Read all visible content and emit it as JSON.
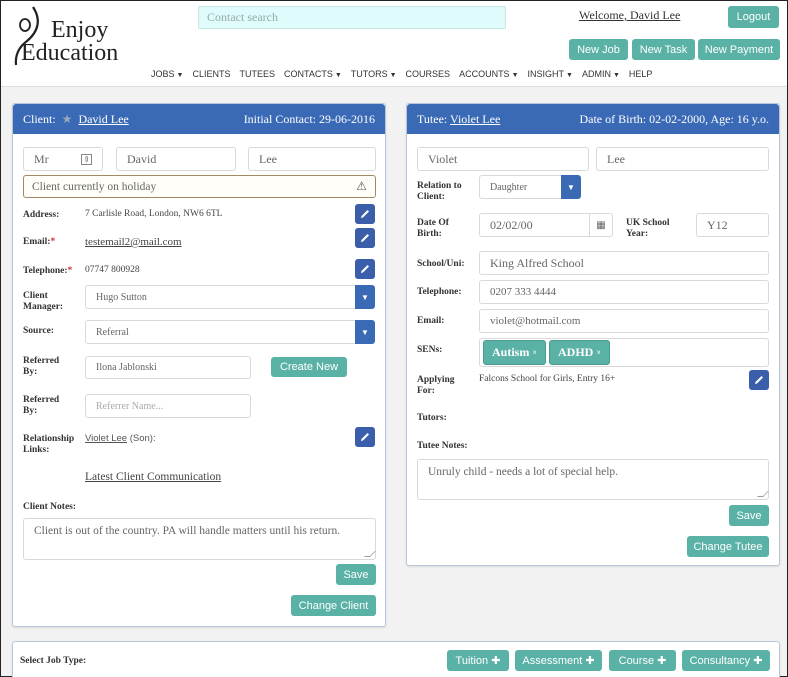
{
  "header": {
    "logo": {
      "line1": "Enjoy",
      "line2": "Education"
    },
    "search_placeholder": "Contact search",
    "welcome": "Welcome, David Lee",
    "logout": "Logout",
    "actions": [
      "New Job",
      "New Task",
      "New Payment"
    ]
  },
  "nav": [
    {
      "label": "JOBS",
      "dropdown": true
    },
    {
      "label": "CLIENTS",
      "dropdown": false
    },
    {
      "label": "TUTEES",
      "dropdown": false
    },
    {
      "label": "CONTACTS",
      "dropdown": true
    },
    {
      "label": "TUTORS",
      "dropdown": true
    },
    {
      "label": "COURSES",
      "dropdown": false
    },
    {
      "label": "ACCOUNTS",
      "dropdown": true
    },
    {
      "label": "INSIGHT",
      "dropdown": true
    },
    {
      "label": "ADMIN",
      "dropdown": true
    },
    {
      "label": "HELP",
      "dropdown": false
    }
  ],
  "client": {
    "header_label": "Client:",
    "name_link": "David Lee",
    "initial_contact": "Initial Contact: 29-06-2016",
    "title": "Mr",
    "first_name": "David",
    "last_name": "Lee",
    "alert": "Client currently on holiday",
    "address_label": "Address:",
    "address": "7 Carlisle Road, London, NW6 6TL",
    "email_label": "Email:",
    "email": "testemail2@mail.com",
    "telephone_label": "Telephone:",
    "telephone": "07747 800928",
    "manager_label": "Client Manager:",
    "manager": "Hugo Sutton",
    "source_label": "Source:",
    "source": "Referral",
    "referred_label": "Referred By:",
    "referred_by": "Ilona Jablonski",
    "create_new": "Create New",
    "referred2_label": "Referred By:",
    "referrer_placeholder": "Referrer Name...",
    "relationship_label": "Relationship Links:",
    "relationship_link": "Violet Lee",
    "relationship_suffix": "(Son):",
    "latest_comm": "Latest Client Communication",
    "notes_label": "Client Notes:",
    "notes": "Client is out of the country. PA will handle matters until his return.",
    "save": "Save",
    "change": "Change Client"
  },
  "tutee": {
    "header_label": "Tutee:",
    "name_link": "Violet Lee",
    "dob_summary": "Date of Birth: 02-02-2000, Age: 16 y.o.",
    "first_name": "Violet",
    "last_name": "Lee",
    "relation_label": "Relation to Client:",
    "relation": "Daughter",
    "dob_label": "Date Of Birth:",
    "dob": "02/02/00",
    "school_year_label": "UK School Year:",
    "school_year": "Y12",
    "school_label": "School/Uni:",
    "school": "King Alfred School",
    "telephone_label": "Telephone:",
    "telephone": "0207 333 4444",
    "email_label": "Email:",
    "email": "violet@hotmail.com",
    "sens_label": "SENs:",
    "sens": [
      "Autism",
      "ADHD"
    ],
    "applying_label": "Applying For:",
    "applying": "Falcons School for Girls, Entry 16+",
    "tutors_label": "Tutors:",
    "notes_label": "Tutee Notes:",
    "notes": "Unruly child - needs a lot of special help.",
    "save": "Save",
    "change": "Change Tutee"
  },
  "job_type": {
    "label": "Select Job Type:",
    "buttons": [
      "Tuition",
      "Assessment",
      "Course",
      "Consultancy"
    ]
  },
  "colors": {
    "primary_blue": "#3a6ab6",
    "teal": "#5ab1a6",
    "search_bg": "#dffbfb"
  }
}
